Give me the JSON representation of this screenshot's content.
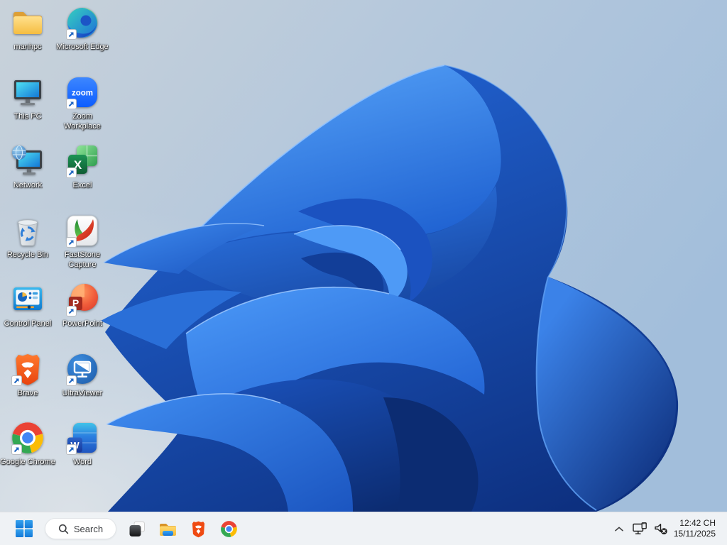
{
  "wallpaper": {
    "name": "windows-11-bloom",
    "background_top_left": "#c9d3db",
    "background_right": "#a2bedb",
    "bloom_bright": "#4f9df8",
    "bloom_mid": "#2163d6",
    "bloom_dark": "#0d2f7f"
  },
  "desktop": {
    "icons": [
      {
        "label": "manhpc",
        "icon": "folder",
        "shortcut": false
      },
      {
        "label": "Microsoft Edge",
        "icon": "edge-browser",
        "shortcut": true
      },
      {
        "label": "This PC",
        "icon": "this-pc-monitor",
        "shortcut": false
      },
      {
        "label": "Zoom Workplace",
        "icon": "zoom-app",
        "shortcut": true
      },
      {
        "label": "Network",
        "icon": "network-globe",
        "shortcut": false
      },
      {
        "label": "Excel",
        "icon": "excel-app",
        "shortcut": true
      },
      {
        "label": "Recycle Bin",
        "icon": "recycle-bin",
        "shortcut": false
      },
      {
        "label": "FastStone Capture",
        "icon": "faststone-capture",
        "shortcut": true
      },
      {
        "label": "Control Panel",
        "icon": "control-panel",
        "shortcut": false
      },
      {
        "label": "PowerPoint",
        "icon": "powerpoint-app",
        "shortcut": true
      },
      {
        "label": "Brave",
        "icon": "brave-browser",
        "shortcut": true
      },
      {
        "label": "UltraViewer",
        "icon": "ultraviewer-app",
        "shortcut": true
      },
      {
        "label": "Google Chrome",
        "icon": "chrome-browser",
        "shortcut": true
      },
      {
        "label": "Word",
        "icon": "word-app",
        "shortcut": true
      }
    ]
  },
  "taskbar": {
    "alignment": "left",
    "background": "#eff2f5",
    "search": {
      "label": "Search",
      "icon": "search-magnifier"
    },
    "app_buttons": [
      {
        "icon": "start-windows-logo"
      },
      {
        "icon": "task-view"
      },
      {
        "icon": "file-explorer-folder"
      },
      {
        "icon": "brave-browser"
      },
      {
        "icon": "chrome-browser"
      }
    ],
    "tray": {
      "chevron_icon": "chevron-up-hidden-icons",
      "network_icon": "network-wired-monitor",
      "volume_icon": "volume-muted",
      "time": "12:42 CH",
      "date": "15/11/2025"
    }
  }
}
